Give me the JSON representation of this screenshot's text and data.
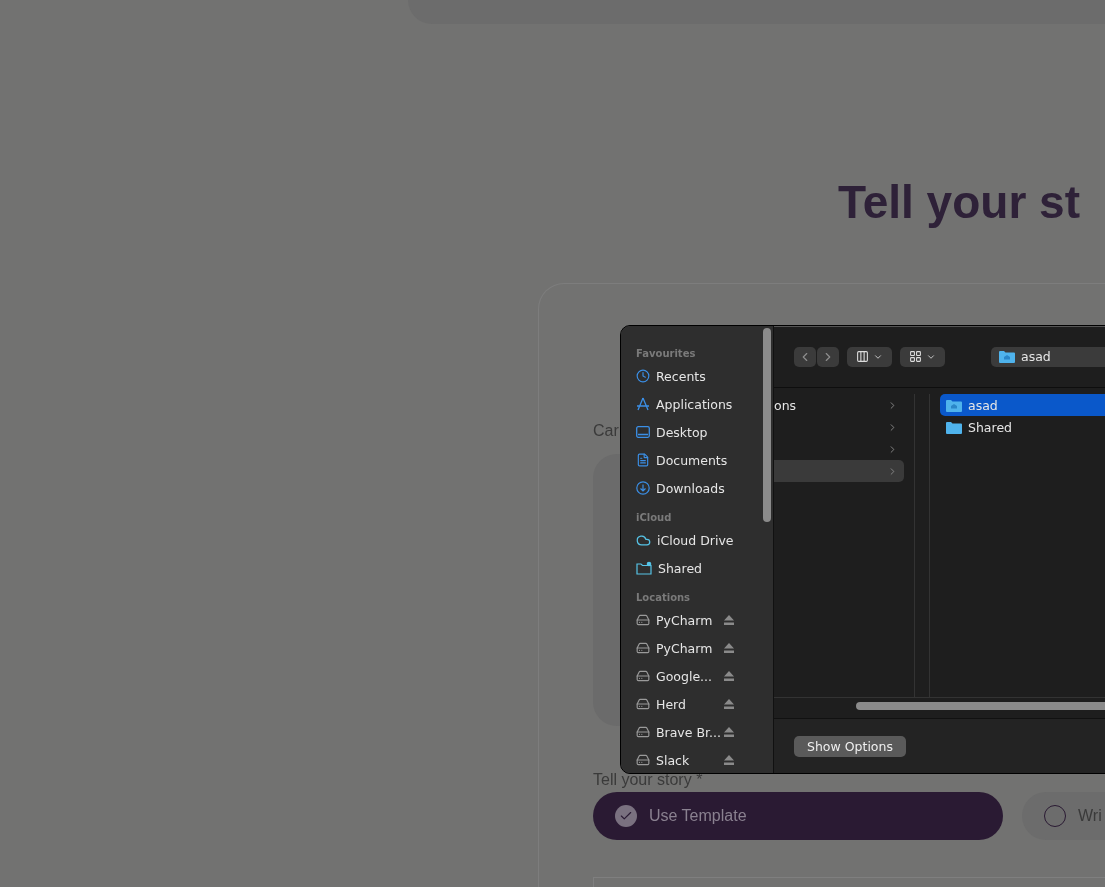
{
  "page": {
    "title": "Tell your st",
    "upload_label": "Car",
    "story_label": "Tell your story *",
    "story_options": [
      {
        "label": "Use Template",
        "selected": true
      },
      {
        "label": "Wri",
        "selected": false
      }
    ]
  },
  "file_dialog": {
    "path": "asad",
    "sidebar": [
      {
        "heading": "Favourites",
        "items": [
          {
            "label": "Recents",
            "kind": "clock"
          },
          {
            "label": "Applications",
            "kind": "apps"
          },
          {
            "label": "Desktop",
            "kind": "desktop"
          },
          {
            "label": "Documents",
            "kind": "document"
          },
          {
            "label": "Downloads",
            "kind": "download"
          }
        ]
      },
      {
        "heading": "iCloud",
        "items": [
          {
            "label": "iCloud Drive",
            "kind": "cloud"
          },
          {
            "label": "Shared",
            "kind": "shared"
          }
        ]
      },
      {
        "heading": "Locations",
        "items": [
          {
            "label": "PyCharm",
            "kind": "drive",
            "ejectable": true
          },
          {
            "label": "PyCharm",
            "kind": "drive",
            "ejectable": true
          },
          {
            "label": "Google...",
            "kind": "drive",
            "ejectable": true
          },
          {
            "label": "Herd",
            "kind": "drive",
            "ejectable": true
          },
          {
            "label": "Brave Br...",
            "kind": "drive",
            "ejectable": true
          },
          {
            "label": "Slack",
            "kind": "drive",
            "ejectable": true
          }
        ]
      }
    ],
    "column_1": [
      {
        "label": "ons",
        "selected": false
      },
      {
        "selected": false
      },
      {
        "selected": false
      },
      {
        "selected": true
      }
    ],
    "column_3": [
      {
        "label": "asad",
        "kind": "home",
        "selected": true
      },
      {
        "label": "Shared",
        "kind": "folder",
        "selected": false
      }
    ],
    "show_options": "Show Options"
  }
}
